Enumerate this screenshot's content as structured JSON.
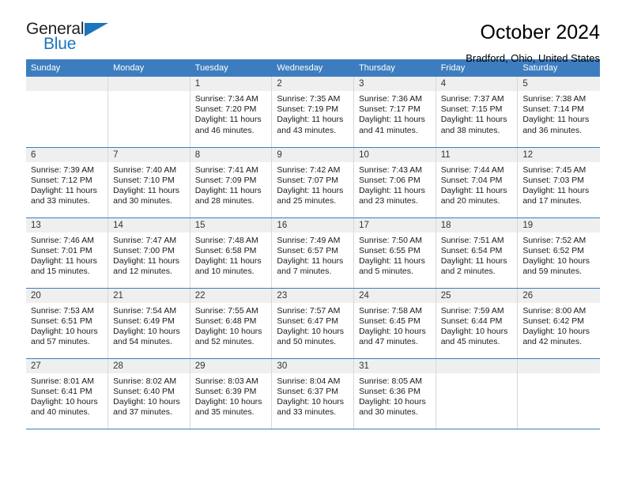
{
  "brand": {
    "name_part1": "General",
    "name_part2": "Blue",
    "accent_color": "#1b75bb"
  },
  "header": {
    "month_title": "October 2024",
    "location": "Bradford, Ohio, United States",
    "header_bg_color": "#3d7dbf",
    "daynum_bg_color": "#efefef"
  },
  "weekday_headers": [
    "Sunday",
    "Monday",
    "Tuesday",
    "Wednesday",
    "Thursday",
    "Friday",
    "Saturday"
  ],
  "labels": {
    "sunrise_prefix": "Sunrise:",
    "sunset_prefix": "Sunset:",
    "daylight_prefix": "Daylight:"
  },
  "weeks": [
    [
      {
        "day": "",
        "empty": true
      },
      {
        "day": "",
        "empty": true
      },
      {
        "day": "1",
        "sunrise": "Sunrise: 7:34 AM",
        "sunset": "Sunset: 7:20 PM",
        "daylight_line1": "Daylight: 11 hours",
        "daylight_line2": "and 46 minutes."
      },
      {
        "day": "2",
        "sunrise": "Sunrise: 7:35 AM",
        "sunset": "Sunset: 7:19 PM",
        "daylight_line1": "Daylight: 11 hours",
        "daylight_line2": "and 43 minutes."
      },
      {
        "day": "3",
        "sunrise": "Sunrise: 7:36 AM",
        "sunset": "Sunset: 7:17 PM",
        "daylight_line1": "Daylight: 11 hours",
        "daylight_line2": "and 41 minutes."
      },
      {
        "day": "4",
        "sunrise": "Sunrise: 7:37 AM",
        "sunset": "Sunset: 7:15 PM",
        "daylight_line1": "Daylight: 11 hours",
        "daylight_line2": "and 38 minutes."
      },
      {
        "day": "5",
        "sunrise": "Sunrise: 7:38 AM",
        "sunset": "Sunset: 7:14 PM",
        "daylight_line1": "Daylight: 11 hours",
        "daylight_line2": "and 36 minutes."
      }
    ],
    [
      {
        "day": "6",
        "sunrise": "Sunrise: 7:39 AM",
        "sunset": "Sunset: 7:12 PM",
        "daylight_line1": "Daylight: 11 hours",
        "daylight_line2": "and 33 minutes."
      },
      {
        "day": "7",
        "sunrise": "Sunrise: 7:40 AM",
        "sunset": "Sunset: 7:10 PM",
        "daylight_line1": "Daylight: 11 hours",
        "daylight_line2": "and 30 minutes."
      },
      {
        "day": "8",
        "sunrise": "Sunrise: 7:41 AM",
        "sunset": "Sunset: 7:09 PM",
        "daylight_line1": "Daylight: 11 hours",
        "daylight_line2": "and 28 minutes."
      },
      {
        "day": "9",
        "sunrise": "Sunrise: 7:42 AM",
        "sunset": "Sunset: 7:07 PM",
        "daylight_line1": "Daylight: 11 hours",
        "daylight_line2": "and 25 minutes."
      },
      {
        "day": "10",
        "sunrise": "Sunrise: 7:43 AM",
        "sunset": "Sunset: 7:06 PM",
        "daylight_line1": "Daylight: 11 hours",
        "daylight_line2": "and 23 minutes."
      },
      {
        "day": "11",
        "sunrise": "Sunrise: 7:44 AM",
        "sunset": "Sunset: 7:04 PM",
        "daylight_line1": "Daylight: 11 hours",
        "daylight_line2": "and 20 minutes."
      },
      {
        "day": "12",
        "sunrise": "Sunrise: 7:45 AM",
        "sunset": "Sunset: 7:03 PM",
        "daylight_line1": "Daylight: 11 hours",
        "daylight_line2": "and 17 minutes."
      }
    ],
    [
      {
        "day": "13",
        "sunrise": "Sunrise: 7:46 AM",
        "sunset": "Sunset: 7:01 PM",
        "daylight_line1": "Daylight: 11 hours",
        "daylight_line2": "and 15 minutes."
      },
      {
        "day": "14",
        "sunrise": "Sunrise: 7:47 AM",
        "sunset": "Sunset: 7:00 PM",
        "daylight_line1": "Daylight: 11 hours",
        "daylight_line2": "and 12 minutes."
      },
      {
        "day": "15",
        "sunrise": "Sunrise: 7:48 AM",
        "sunset": "Sunset: 6:58 PM",
        "daylight_line1": "Daylight: 11 hours",
        "daylight_line2": "and 10 minutes."
      },
      {
        "day": "16",
        "sunrise": "Sunrise: 7:49 AM",
        "sunset": "Sunset: 6:57 PM",
        "daylight_line1": "Daylight: 11 hours",
        "daylight_line2": "and 7 minutes."
      },
      {
        "day": "17",
        "sunrise": "Sunrise: 7:50 AM",
        "sunset": "Sunset: 6:55 PM",
        "daylight_line1": "Daylight: 11 hours",
        "daylight_line2": "and 5 minutes."
      },
      {
        "day": "18",
        "sunrise": "Sunrise: 7:51 AM",
        "sunset": "Sunset: 6:54 PM",
        "daylight_line1": "Daylight: 11 hours",
        "daylight_line2": "and 2 minutes."
      },
      {
        "day": "19",
        "sunrise": "Sunrise: 7:52 AM",
        "sunset": "Sunset: 6:52 PM",
        "daylight_line1": "Daylight: 10 hours",
        "daylight_line2": "and 59 minutes."
      }
    ],
    [
      {
        "day": "20",
        "sunrise": "Sunrise: 7:53 AM",
        "sunset": "Sunset: 6:51 PM",
        "daylight_line1": "Daylight: 10 hours",
        "daylight_line2": "and 57 minutes."
      },
      {
        "day": "21",
        "sunrise": "Sunrise: 7:54 AM",
        "sunset": "Sunset: 6:49 PM",
        "daylight_line1": "Daylight: 10 hours",
        "daylight_line2": "and 54 minutes."
      },
      {
        "day": "22",
        "sunrise": "Sunrise: 7:55 AM",
        "sunset": "Sunset: 6:48 PM",
        "daylight_line1": "Daylight: 10 hours",
        "daylight_line2": "and 52 minutes."
      },
      {
        "day": "23",
        "sunrise": "Sunrise: 7:57 AM",
        "sunset": "Sunset: 6:47 PM",
        "daylight_line1": "Daylight: 10 hours",
        "daylight_line2": "and 50 minutes."
      },
      {
        "day": "24",
        "sunrise": "Sunrise: 7:58 AM",
        "sunset": "Sunset: 6:45 PM",
        "daylight_line1": "Daylight: 10 hours",
        "daylight_line2": "and 47 minutes."
      },
      {
        "day": "25",
        "sunrise": "Sunrise: 7:59 AM",
        "sunset": "Sunset: 6:44 PM",
        "daylight_line1": "Daylight: 10 hours",
        "daylight_line2": "and 45 minutes."
      },
      {
        "day": "26",
        "sunrise": "Sunrise: 8:00 AM",
        "sunset": "Sunset: 6:42 PM",
        "daylight_line1": "Daylight: 10 hours",
        "daylight_line2": "and 42 minutes."
      }
    ],
    [
      {
        "day": "27",
        "sunrise": "Sunrise: 8:01 AM",
        "sunset": "Sunset: 6:41 PM",
        "daylight_line1": "Daylight: 10 hours",
        "daylight_line2": "and 40 minutes."
      },
      {
        "day": "28",
        "sunrise": "Sunrise: 8:02 AM",
        "sunset": "Sunset: 6:40 PM",
        "daylight_line1": "Daylight: 10 hours",
        "daylight_line2": "and 37 minutes."
      },
      {
        "day": "29",
        "sunrise": "Sunrise: 8:03 AM",
        "sunset": "Sunset: 6:39 PM",
        "daylight_line1": "Daylight: 10 hours",
        "daylight_line2": "and 35 minutes."
      },
      {
        "day": "30",
        "sunrise": "Sunrise: 8:04 AM",
        "sunset": "Sunset: 6:37 PM",
        "daylight_line1": "Daylight: 10 hours",
        "daylight_line2": "and 33 minutes."
      },
      {
        "day": "31",
        "sunrise": "Sunrise: 8:05 AM",
        "sunset": "Sunset: 6:36 PM",
        "daylight_line1": "Daylight: 10 hours",
        "daylight_line2": "and 30 minutes."
      },
      {
        "day": "",
        "empty": true
      },
      {
        "day": "",
        "empty": true
      }
    ]
  ]
}
